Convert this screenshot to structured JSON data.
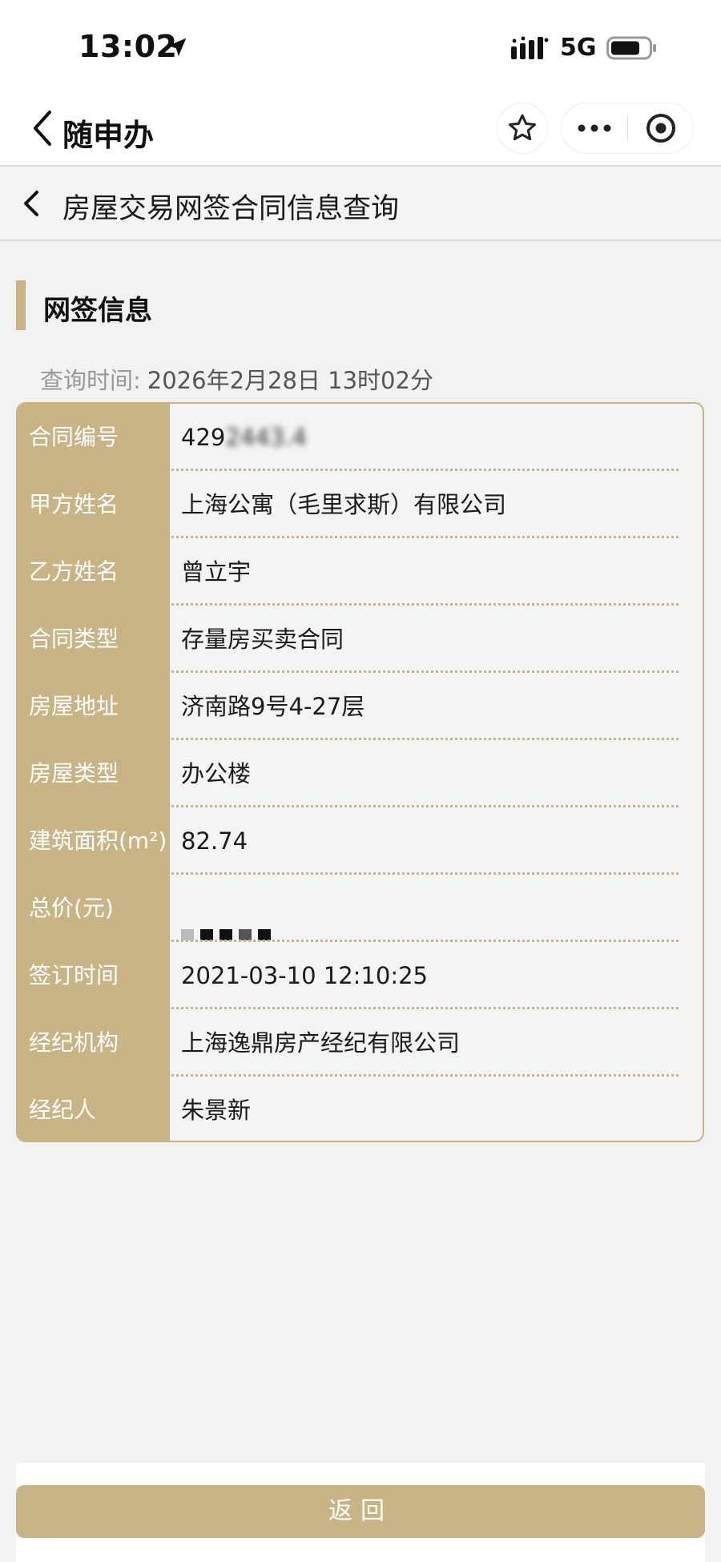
{
  "status_bar": {
    "time": "13:02",
    "network": "5G",
    "icons": [
      "location-arrow-icon",
      "signal-icon",
      "battery-icon"
    ]
  },
  "navbar": {
    "title": "随申办",
    "icons": [
      "chevron-left-icon",
      "star-icon",
      "more-dots-icon",
      "target-close-icon"
    ]
  },
  "page": {
    "title": "房屋交易网签合同信息查询"
  },
  "section": {
    "title": "网签信息"
  },
  "query": {
    "label": "查询时间:",
    "value": "2026年2月28日 13时02分"
  },
  "rows": [
    {
      "label": "合同编号",
      "value": "429******"
    },
    {
      "label": "甲方姓名",
      "value": "上海公寓（毛里求斯）有限公司"
    },
    {
      "label": "乙方姓名",
      "value": "曾立宇"
    },
    {
      "label": "合同类型",
      "value": "存量房买卖合同"
    },
    {
      "label": "房屋地址",
      "value": "济南路9号4-27层"
    },
    {
      "label": "房屋类型",
      "value": "办公楼"
    },
    {
      "label": "建筑面积(m²)",
      "value": "82.74"
    },
    {
      "label": "总价(元)",
      "value": ""
    },
    {
      "label": "签订时间",
      "value": "2021-03-10 12:10:25"
    },
    {
      "label": "经纪机构",
      "value": "上海逸鼎房产经纪有限公司"
    },
    {
      "label": "经纪人",
      "value": "朱景新"
    }
  ],
  "buttons": {
    "return_label": "返回"
  },
  "colors": {
    "accent": "#c9b486",
    "background": "#f2f2f2",
    "label_text": "#ffffff"
  }
}
